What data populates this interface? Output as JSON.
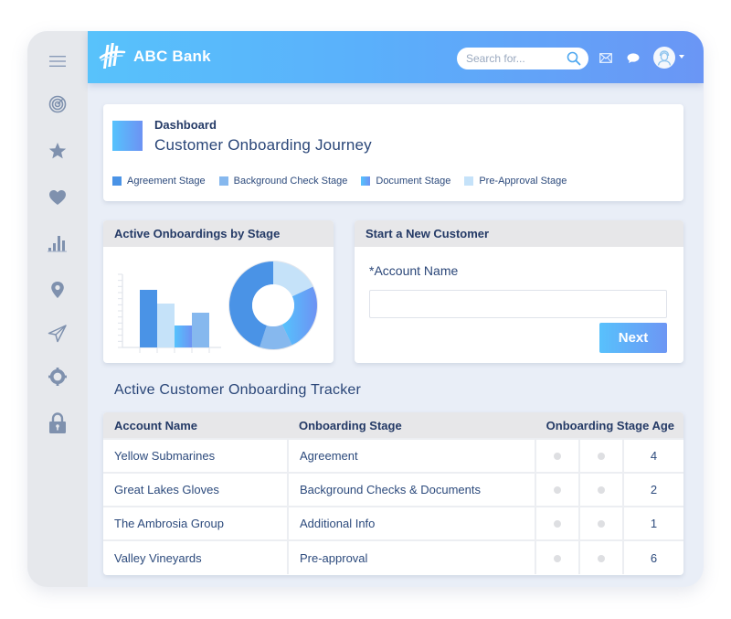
{
  "app": {
    "brand": "ABC Bank",
    "brand_logo_icon": "bank-logo-icon"
  },
  "topbar": {
    "search_placeholder": "Search for...",
    "search_value": "",
    "icons": [
      "search-icon",
      "mail-icon",
      "chat-icon",
      "user-avatar-icon",
      "caret-down-icon"
    ]
  },
  "sidebar": {
    "items": [
      {
        "name": "menu",
        "icon": "hamburger-menu-icon"
      },
      {
        "name": "targets",
        "icon": "target-icon"
      },
      {
        "name": "favorites",
        "icon": "star-icon"
      },
      {
        "name": "likes",
        "icon": "heart-icon"
      },
      {
        "name": "analytics",
        "icon": "bar-chart-icon"
      },
      {
        "name": "locations",
        "icon": "map-pin-icon"
      },
      {
        "name": "send",
        "icon": "paper-plane-icon"
      },
      {
        "name": "settings",
        "icon": "gear-icon"
      },
      {
        "name": "security",
        "icon": "lock-icon"
      }
    ]
  },
  "dashboard": {
    "label": "Dashboard",
    "title": "Customer Onboarding Journey",
    "legend": [
      {
        "label": "Agreement Stage",
        "color": "#4a93e6"
      },
      {
        "label": "Background Check Stage",
        "color": "#86b8ee"
      },
      {
        "label": "Document Stage",
        "color": "#5aa8fb"
      },
      {
        "label": "Pre-Approval Stage",
        "color": "#c5e2f9"
      }
    ]
  },
  "chart_panel": {
    "title": "Active Onboardings by Stage"
  },
  "chart_data": {
    "type": "bar",
    "title": "Active Onboardings by Stage",
    "xlabel": "",
    "ylabel": "",
    "grid": false,
    "categories": [
      "Agreement",
      "Pre-Approval",
      "Document",
      "Background Check"
    ],
    "values": [
      6.3,
      4.8,
      2.4,
      3.8
    ],
    "ylim": [
      0,
      8
    ],
    "colors": [
      "#4a93e6",
      "#c5e2f9",
      "#5aa8fb",
      "#86b8ee"
    ],
    "donut": {
      "type": "pie",
      "slices": [
        {
          "label": "Pre-Approval Stage",
          "value": 18,
          "color": "#c5e2f9"
        },
        {
          "label": "Document Stage",
          "value": 25,
          "color": "#5aa8fb"
        },
        {
          "label": "Background Check Stage",
          "value": 12,
          "color": "#86b8ee"
        },
        {
          "label": "Agreement Stage",
          "value": 45,
          "color": "#4a93e6"
        }
      ]
    }
  },
  "new_customer": {
    "title": "Start a New Customer",
    "field_label": "*Account Name",
    "field_value": "",
    "next_label": "Next"
  },
  "tracker": {
    "title": "Active Customer Onboarding Tracker",
    "columns": [
      "Account Name",
      "Onboarding Stage",
      "Onboarding Stage Age"
    ],
    "rows": [
      {
        "account": "Yellow Submarines",
        "stage": "Agreement",
        "age": "4"
      },
      {
        "account": "Great Lakes Gloves",
        "stage": "Background  Checks & Documents",
        "age": "2"
      },
      {
        "account": "The Ambrosia Group",
        "stage": "Additional Info",
        "age": "1"
      },
      {
        "account": "Valley Vineyards",
        "stage": "Pre-approval",
        "age": "6"
      }
    ]
  }
}
